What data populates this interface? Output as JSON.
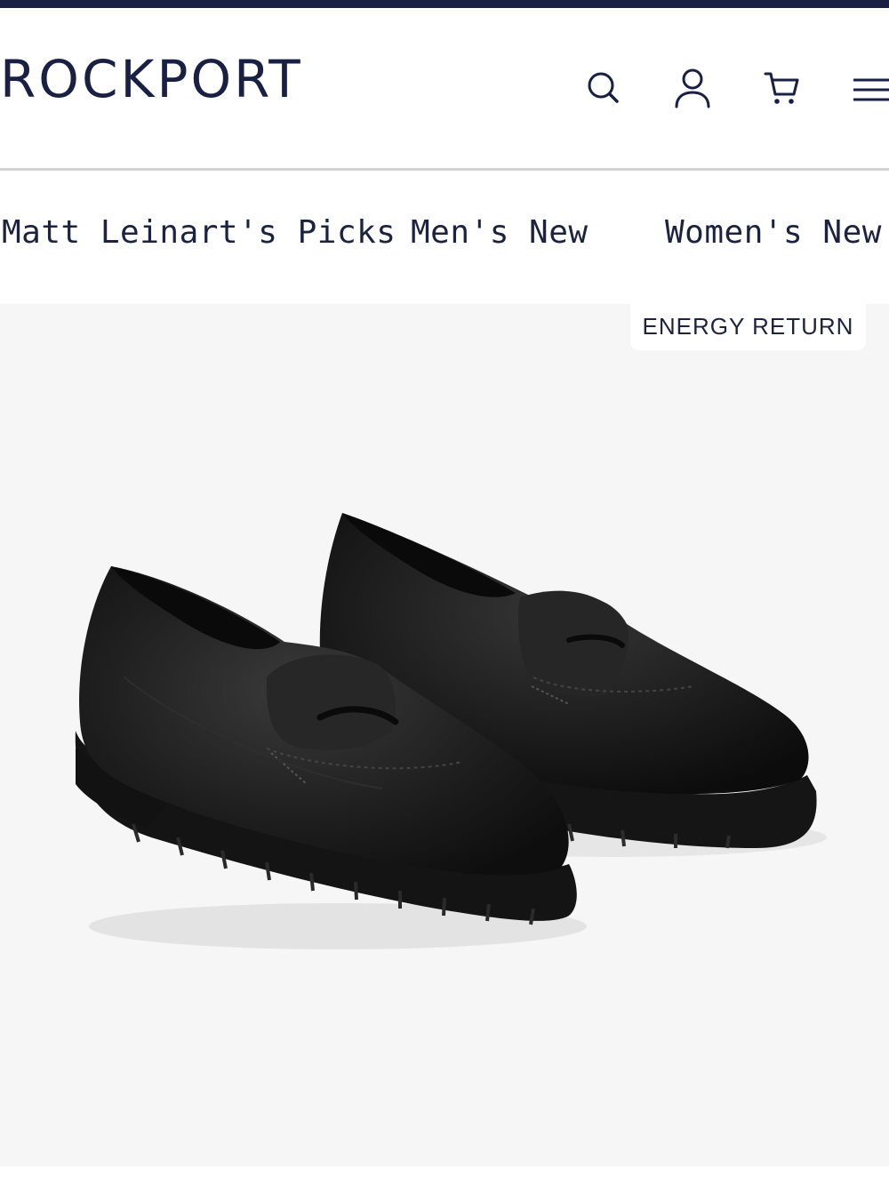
{
  "brand": {
    "logo": "ROCKPORT",
    "accent": "#1a2044"
  },
  "header": {
    "icons": [
      "search-icon",
      "account-icon",
      "cart-icon",
      "menu-icon"
    ]
  },
  "nav": {
    "items": [
      {
        "label": "Matt Leinart's Picks"
      },
      {
        "label": "Men's New"
      },
      {
        "label": "Women's New"
      }
    ]
  },
  "product": {
    "badge": "ENERGY RETURN",
    "image": "black-leather-penny-loafers"
  }
}
